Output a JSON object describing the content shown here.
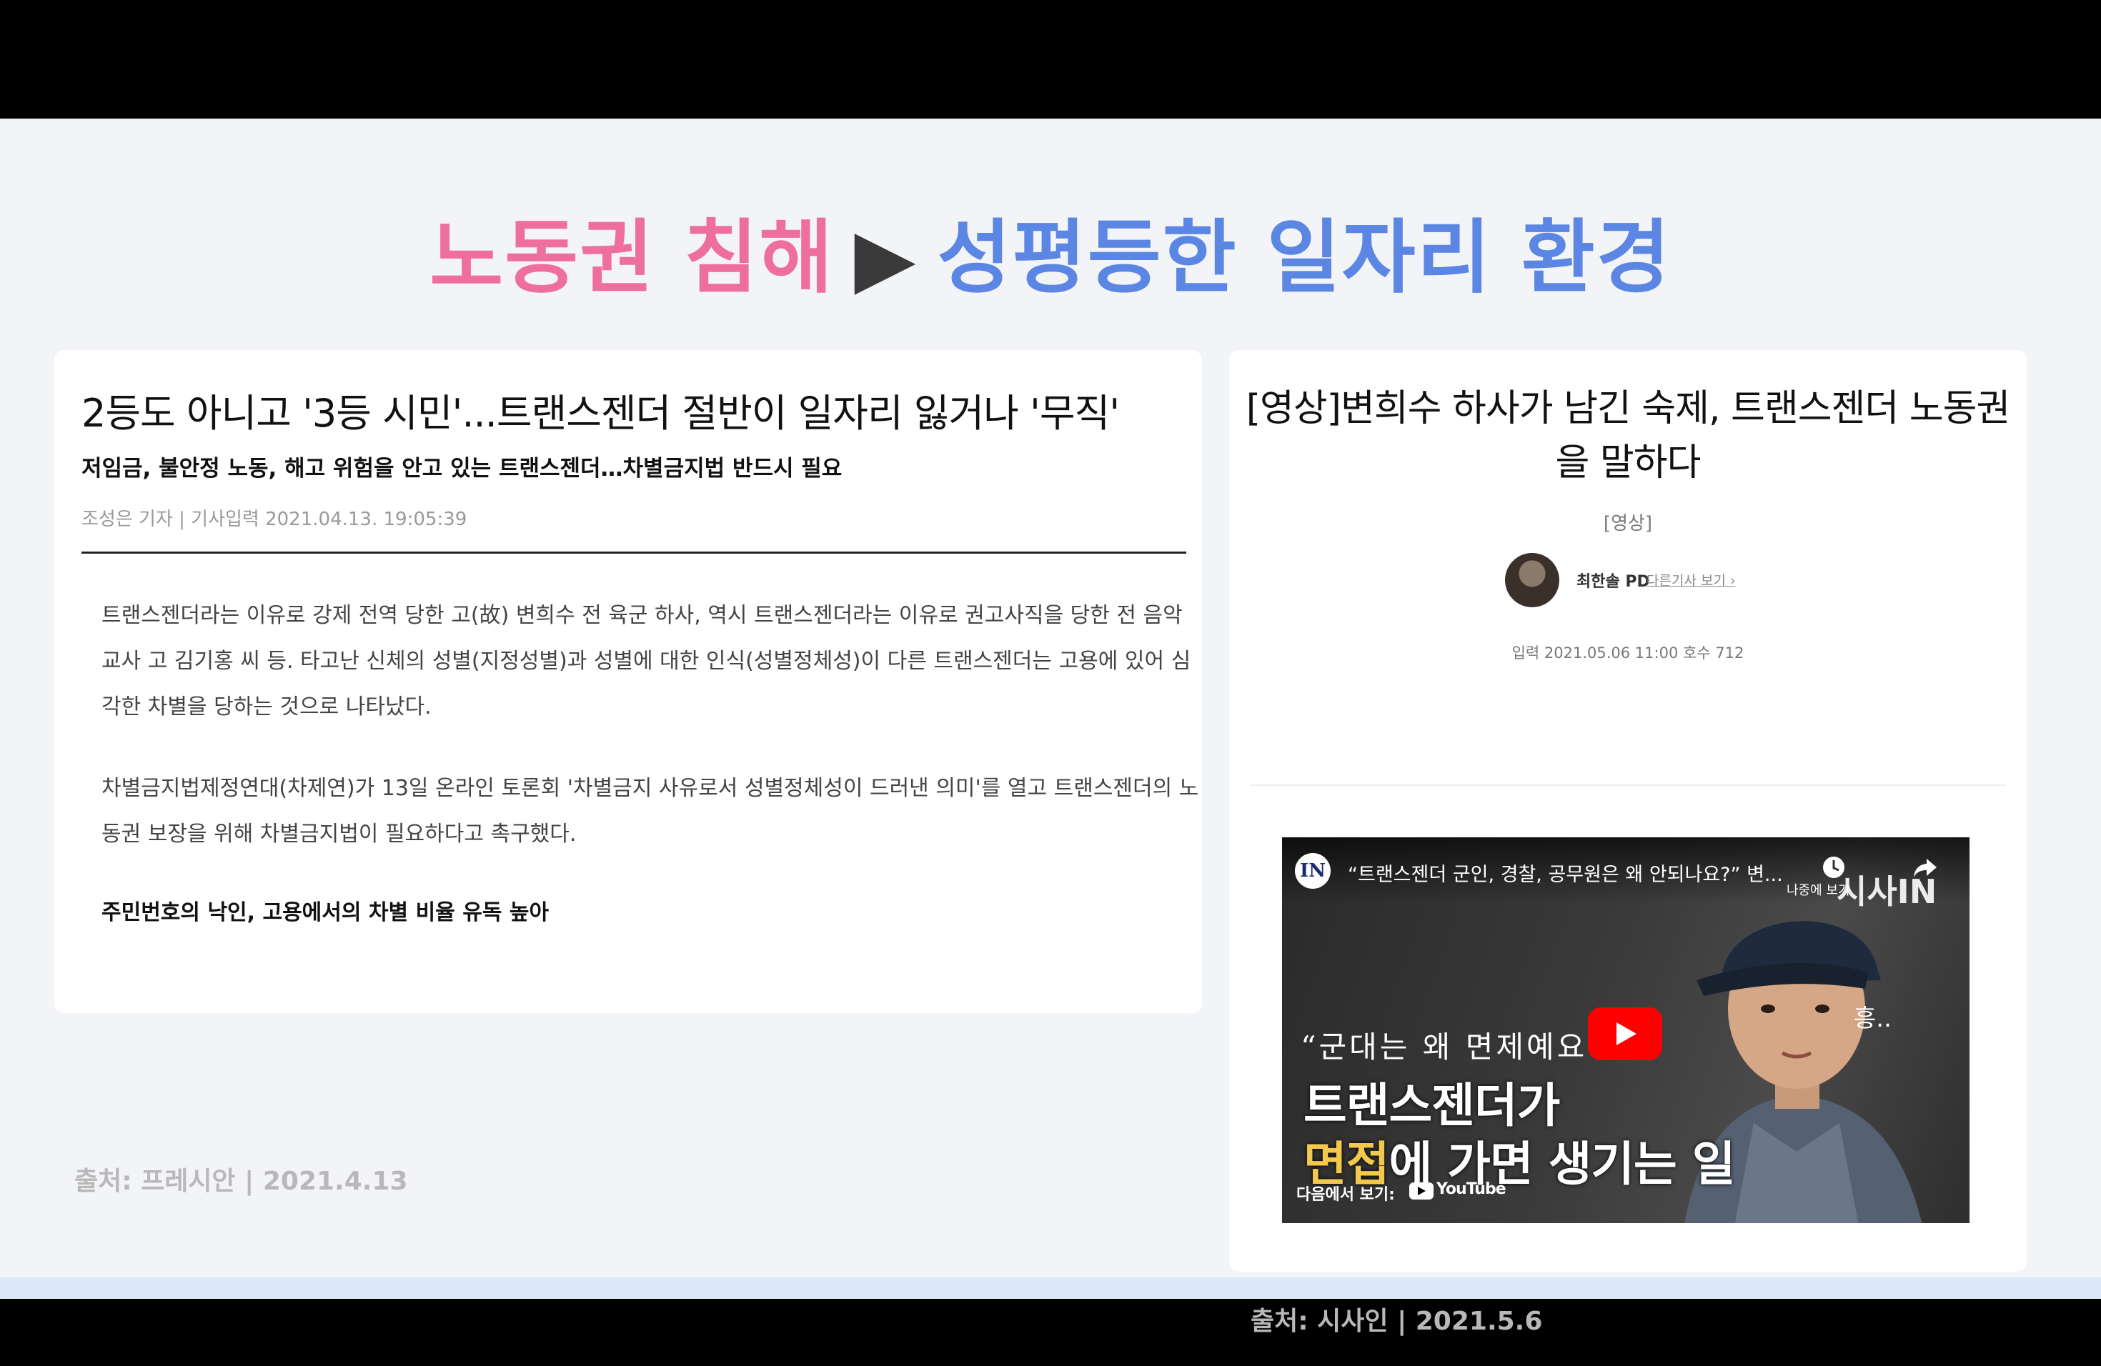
{
  "headline": {
    "part1": "노동권 침해",
    "arrow": "▶",
    "part2": "성평등한 일자리 환경",
    "colors": {
      "pink": "#ef6f9c",
      "blue": "#5b86e3"
    }
  },
  "left_article": {
    "title": "2등도 아니고 '3등 시민'...트랜스젠더 절반이 일자리 잃거나 '무직'",
    "subtitle": "저임금, 불안정 노동, 해고 위험을 안고 있는 트랜스젠더…차별금지법 반드시 필요",
    "meta": "조성은 기자 | 기사입력 2021.04.13. 19:05:39",
    "paragraph1": "트랜스젠더라는 이유로 강제 전역 당한 고(故) 변희수 전 육군 하사, 역시 트랜스젠더라는 이유로 권고사직을 당한 전 음악교사 고 김기홍 씨 등. 타고난 신체의 성별(지정성별)과 성별에 대한 인식(성별정체성)이 다른 트랜스젠더는 고용에 있어 심각한 차별을 당하는 것으로 나타났다.",
    "paragraph2": "차별금지법제정연대(차제연)가 13일 온라인 토론회 '차별금지 사유로서 성별정체성이 드러낸 의미'를 열고 트랜스젠더의 노동권 보장을 위해 차별금지법이 필요하다고 촉구했다.",
    "bold_heading": "주민번호의 낙인, 고용에서의 차별 비율 유독 높아",
    "source": "출처: 프레시안 | 2021.4.13"
  },
  "right_article": {
    "title": "[영상]변희수 하사가 남긴 숙제, 트랜스젠더 노동권을 말하다",
    "category": "[영상]",
    "author": "최한솔 PD",
    "more_link": "다른기사 보기 ›",
    "date": "입력 2021.05.06 11:00   호수 712",
    "source": "출처: 시사인 | 2021.5.6",
    "video": {
      "channel_logo": "IN",
      "title": "“트랜스젠더 군인, 경찰, 공무원은 왜 안되나요?” 변...",
      "watch_later": "나중에 보기",
      "share": "공유",
      "brand": "시사IN",
      "quote": "“군대는 왜 면제예요",
      "caption_line1": "트랜스젠더가",
      "caption_line2_highlight": "면접",
      "caption_line2_rest": "에 가면 생기는 일",
      "hum": "흥..",
      "watch_on": "다음에서 보기:",
      "youtube": "YouTube"
    }
  }
}
